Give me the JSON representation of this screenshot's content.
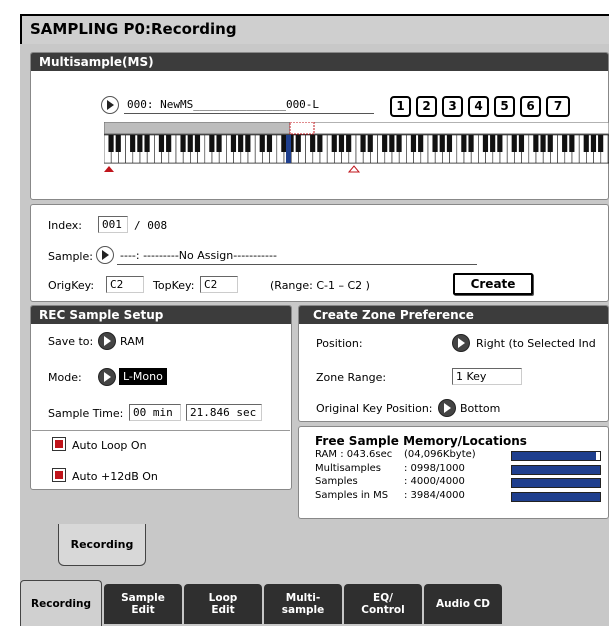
{
  "title": "SAMPLING P0:Recording",
  "multisample": {
    "header": "Multisample(MS)",
    "ms_select_value": "000: NewMS______________000-L",
    "bank_buttons": [
      "1",
      "2",
      "3",
      "4",
      "5",
      "6",
      "7"
    ]
  },
  "index": {
    "label": "Index:",
    "current": "001",
    "total": "/ 008"
  },
  "sample": {
    "label": "Sample:",
    "value": "----: ---------No Assign-----------"
  },
  "orig_key": {
    "label": "OrigKey:",
    "value": "C2"
  },
  "top_key": {
    "label": "TopKey:",
    "value": "C2"
  },
  "range_text": "(Range: C-1  – C2   )",
  "create_label": "Create",
  "rec_setup": {
    "header": "REC Sample Setup",
    "save_to_label": "Save to:",
    "save_to_value": "RAM",
    "mode_label": "Mode:",
    "mode_value": "L-Mono",
    "sample_time_label": "Sample Time:",
    "sample_time_min": "00 min",
    "sample_time_sec": "21.846 sec",
    "auto_loop_label": "Auto Loop On",
    "auto_12db_label": "Auto +12dB On"
  },
  "zone_pref": {
    "header": "Create Zone Preference",
    "position_label": "Position:",
    "position_value": "Right (to Selected Ind",
    "zone_range_label": "Zone Range:",
    "zone_range_value": "1 Key",
    "orig_key_pos_label": "Original Key Position:",
    "orig_key_pos_value": "Bottom"
  },
  "free_memory": {
    "title": "Free Sample Memory/Locations",
    "rows": [
      {
        "label": "RAM : 043.6sec",
        "value": "(04,096Kbyte)",
        "fraction": 0.96
      },
      {
        "label": "Multisamples",
        "value": ": 0998/1000",
        "fraction": 0.998
      },
      {
        "label": "Samples",
        "value": ": 4000/4000",
        "fraction": 1.0
      },
      {
        "label": "Samples in MS",
        "value": ": 3984/4000",
        "fraction": 0.996
      }
    ]
  },
  "page_tab_label": "Recording",
  "tabs": [
    {
      "line1": "Recording",
      "line2": ""
    },
    {
      "line1": "Sample",
      "line2": "Edit"
    },
    {
      "line1": "Loop",
      "line2": "Edit"
    },
    {
      "line1": "Multi-",
      "line2": "sample"
    },
    {
      "line1": "EQ/",
      "line2": "Control"
    },
    {
      "line1": "Audio CD",
      "line2": ""
    }
  ],
  "colors": {
    "accent_red": "#c0141b",
    "meter_fill": "#1f3f8e",
    "header_dark": "#3c3c3c"
  }
}
